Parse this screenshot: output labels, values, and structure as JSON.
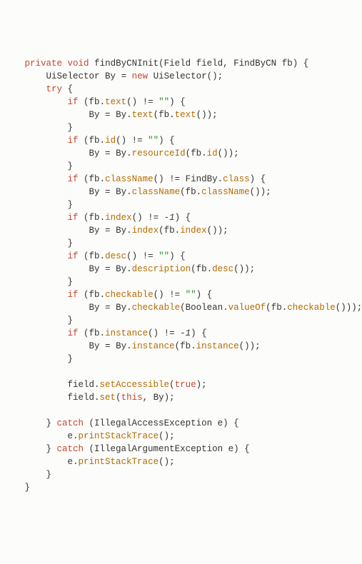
{
  "keywords": {
    "private": "private",
    "void": "void",
    "new": "new",
    "try": "try",
    "if": "if",
    "catch": "catch",
    "this": "this",
    "true": "true",
    "class": "class"
  },
  "identifiers": {
    "findByCNInit": "findByCNInit",
    "Field": "Field",
    "field": "field",
    "FindByCN": "FindByCN",
    "fb": "fb",
    "UiSelector": "UiSelector",
    "By": "By",
    "FindBy": "FindBy",
    "Boolean": "Boolean",
    "IllegalAccessException": "IllegalAccessException",
    "IllegalArgumentException": "IllegalArgumentException",
    "e": "e"
  },
  "methods": {
    "text": "text",
    "id": "id",
    "resourceId": "resourceId",
    "className": "className",
    "index": "index",
    "desc": "desc",
    "description": "description",
    "checkable": "checkable",
    "valueOf": "valueOf",
    "instance": "instance",
    "setAccessible": "setAccessible",
    "set": "set",
    "printStackTrace": "printStackTrace"
  },
  "strings": {
    "empty": "\"\""
  },
  "numbers": {
    "minus1": "-1"
  }
}
